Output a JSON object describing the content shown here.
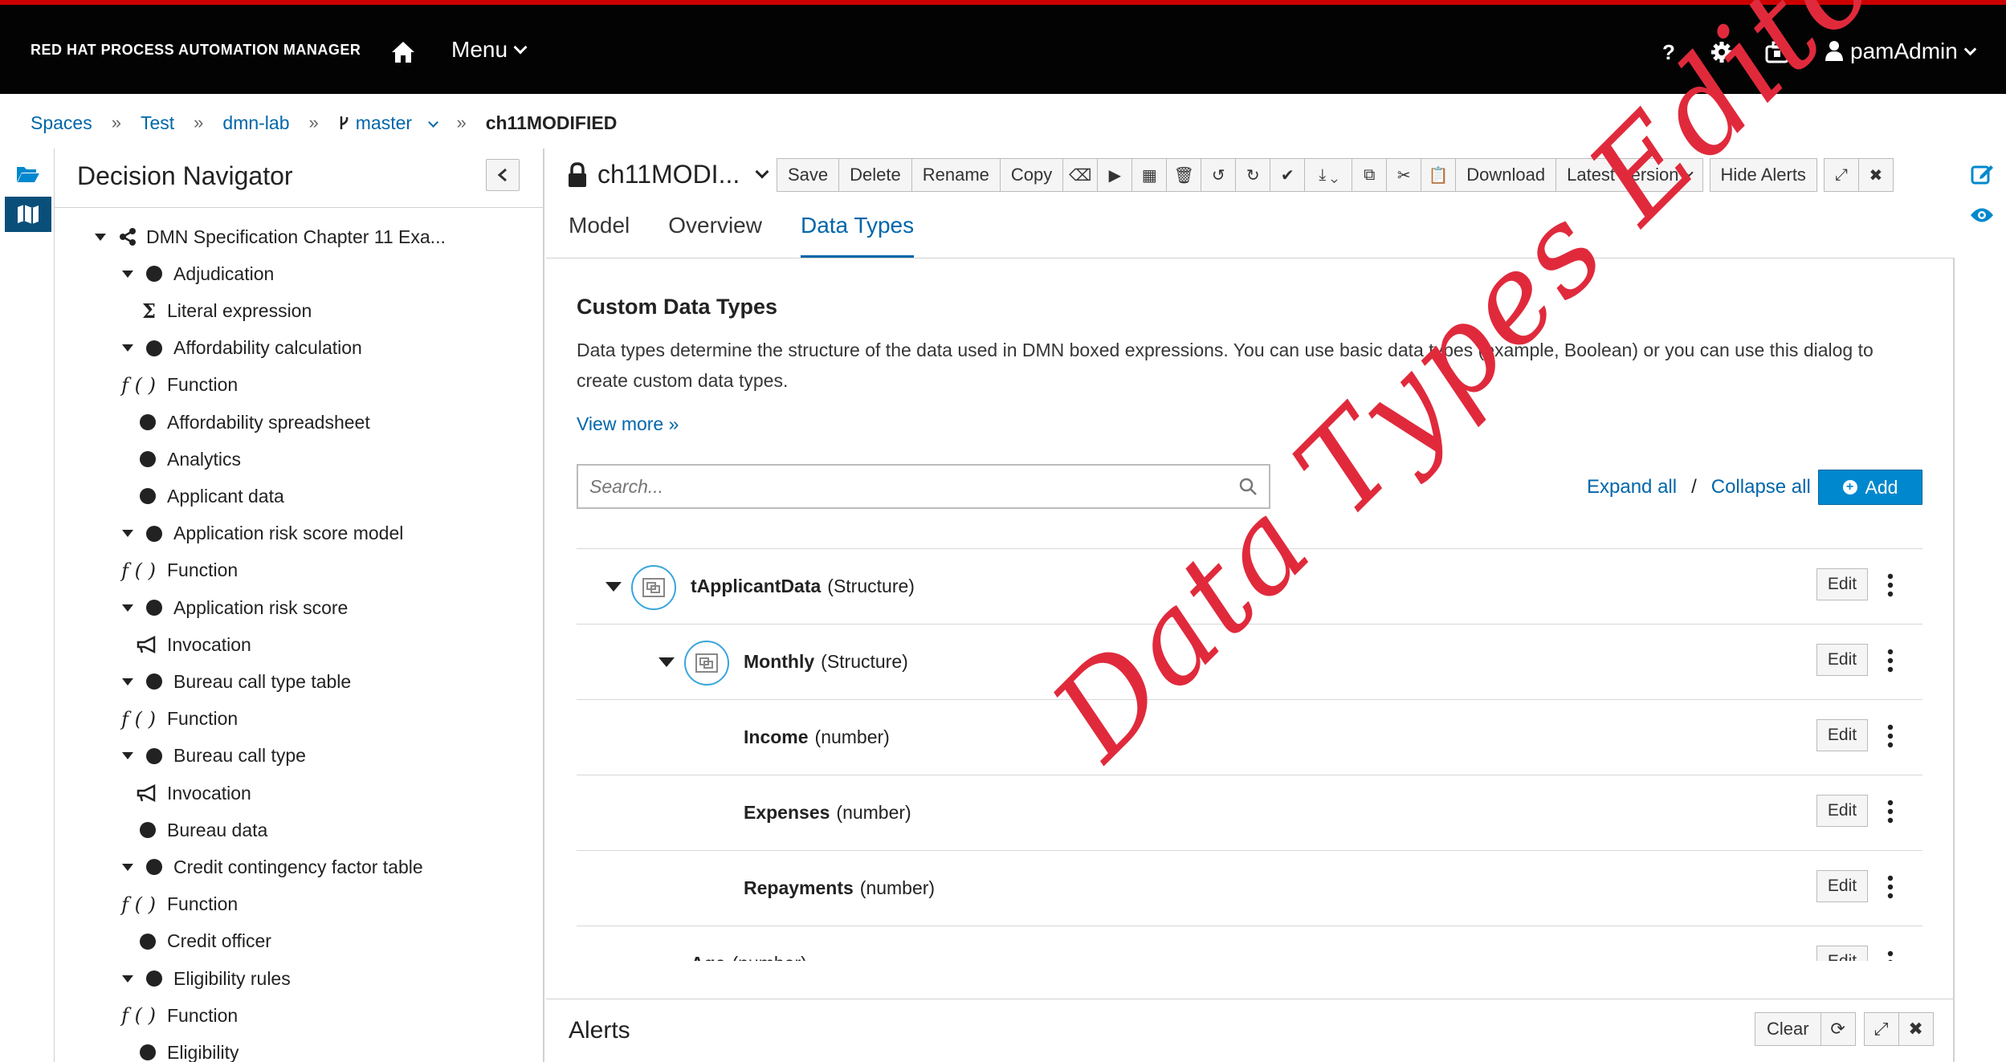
{
  "header": {
    "brand": "RED HAT PROCESS AUTOMATION MANAGER",
    "menu_label": "Menu",
    "user_label": "pamAdmin",
    "help_label": "?"
  },
  "breadcrumb": {
    "items": [
      "Spaces",
      "Test",
      "dmn-lab",
      "master"
    ],
    "current": "ch11MODIFIED",
    "separator": "»"
  },
  "navigator": {
    "title": "Decision Navigator",
    "tree": [
      {
        "label": "DMN Specification Chapter 11 Exa...",
        "kind": "root"
      },
      {
        "label": "Adjudication",
        "kind": "node"
      },
      {
        "label": "Literal expression",
        "kind": "literal",
        "glyph": "Σ"
      },
      {
        "label": "Affordability calculation",
        "kind": "node"
      },
      {
        "label": "Function",
        "kind": "function",
        "glyph": "f ( )"
      },
      {
        "label": "Affordability spreadsheet",
        "kind": "leaf"
      },
      {
        "label": "Analytics",
        "kind": "leaf"
      },
      {
        "label": "Applicant data",
        "kind": "leaf"
      },
      {
        "label": "Application risk score model",
        "kind": "node"
      },
      {
        "label": "Function",
        "kind": "function",
        "glyph": "f ( )"
      },
      {
        "label": "Application risk score",
        "kind": "node"
      },
      {
        "label": "Invocation",
        "kind": "invocation"
      },
      {
        "label": "Bureau call type table",
        "kind": "node"
      },
      {
        "label": "Function",
        "kind": "function",
        "glyph": "f ( )"
      },
      {
        "label": "Bureau call type",
        "kind": "node"
      },
      {
        "label": "Invocation",
        "kind": "invocation"
      },
      {
        "label": "Bureau data",
        "kind": "leaf"
      },
      {
        "label": "Credit contingency factor table",
        "kind": "node"
      },
      {
        "label": "Function",
        "kind": "function",
        "glyph": "f ( )"
      },
      {
        "label": "Credit officer",
        "kind": "leaf"
      },
      {
        "label": "Eligibility rules",
        "kind": "node"
      },
      {
        "label": "Function",
        "kind": "function",
        "glyph": "f ( )"
      },
      {
        "label": "Eligibility",
        "kind": "leaf"
      }
    ]
  },
  "editor": {
    "file_title": "ch11MODI...",
    "toolbar": {
      "save": "Save",
      "delete": "Delete",
      "rename": "Rename",
      "copy": "Copy",
      "download": "Download",
      "latest_version": "Latest Version",
      "hide_alerts": "Hide Alerts"
    },
    "tabs": [
      "Model",
      "Overview",
      "Data Types"
    ],
    "active_tab": "Data Types",
    "section_title": "Custom Data Types",
    "description": "Data types determine the structure of the data used in DMN boxed expressions. You can use basic data types (example, Boolean) or you can use this dialog to create custom data types.",
    "view_more": "View more »",
    "search_placeholder": "Search...",
    "expand_all": "Expand all",
    "slash": "/",
    "collapse_all": "Collapse all",
    "add_label": "Add",
    "edit_label": "Edit",
    "data_types": [
      {
        "name": "tApplicantData",
        "type": "(Structure)",
        "level": 0,
        "structure": true
      },
      {
        "name": "Monthly",
        "type": "(Structure)",
        "level": 1,
        "structure": true
      },
      {
        "name": "Income",
        "type": "(number)",
        "level": 2,
        "structure": false
      },
      {
        "name": "Expenses",
        "type": "(number)",
        "level": 2,
        "structure": false
      },
      {
        "name": "Repayments",
        "type": "(number)",
        "level": 2,
        "structure": false
      },
      {
        "name": "Age",
        "type": "(number)",
        "level": 1,
        "structure": false
      }
    ]
  },
  "alerts": {
    "title": "Alerts",
    "clear_label": "Clear"
  },
  "annotation": {
    "text": "Data Types Editor",
    "color": "#e02a3c"
  },
  "colors": {
    "brand_red": "#cc0000",
    "link_blue": "#0066aa",
    "primary_button": "#0088ce",
    "icon_ring": "#39a5dc"
  }
}
